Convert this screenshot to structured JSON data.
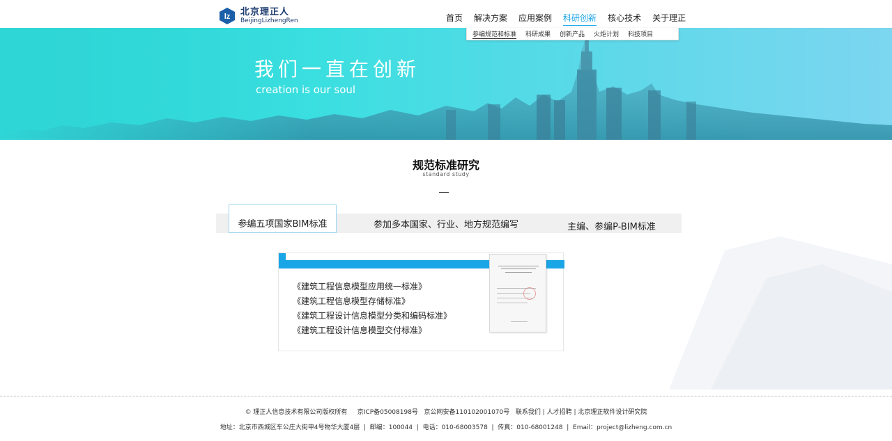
{
  "brand": {
    "logo_mark": "lz",
    "name_cn": "北京理正人",
    "name_en": "BeijingLizhengRen"
  },
  "nav": {
    "items": [
      {
        "label": "首页"
      },
      {
        "label": "解决方案"
      },
      {
        "label": "应用案例"
      },
      {
        "label": "科研创新"
      },
      {
        "label": "核心技术"
      },
      {
        "label": "关于理正"
      }
    ],
    "active": "科研创新"
  },
  "subnav": {
    "items": [
      {
        "label": "参编规范和标准"
      },
      {
        "label": "科研成果"
      },
      {
        "label": "创新产品"
      },
      {
        "label": "火炬计划"
      },
      {
        "label": "科技项目"
      }
    ],
    "active": "参编规范和标准"
  },
  "banner": {
    "title": "我们一直在创新",
    "subtitle": "creation is our soul"
  },
  "section": {
    "title": "规范标准研究",
    "subtitle": "standard study"
  },
  "tabs": [
    {
      "label": "参编五项国家BIM标准"
    },
    {
      "label": "参加多本国家、行业、地方规范编写"
    },
    {
      "label": "主编、参编P-BIM标准"
    }
  ],
  "card": {
    "items": [
      "《建筑工程信息模型应用统一标准》",
      "《建筑工程信息模型存储标准》",
      "《建筑工程设计信息模型分类和编码标准》",
      "《建筑工程设计信息模型交付标准》"
    ]
  },
  "footer": {
    "copyright": "© 理正人信息技术有限公司版权所有",
    "icp": "京ICP备05008198号",
    "police": "京公网安备110102001070号",
    "contact": "联系我们",
    "jobs": "人才招聘",
    "institute": "北京理正软件设计研究院",
    "address": "地址：北京市西城区车公庄大街甲4号物华大厦4层",
    "postcode": "邮编：100044",
    "phone": "电话：010-68003578",
    "fax": "传真：010-68001248",
    "email": "Email：project@lizheng.com.cn"
  },
  "colors": {
    "accent": "#1aa5e6",
    "banner_start": "#2fd6d6",
    "banner_end": "#7cd6f0",
    "brand": "#1a3a6e"
  }
}
